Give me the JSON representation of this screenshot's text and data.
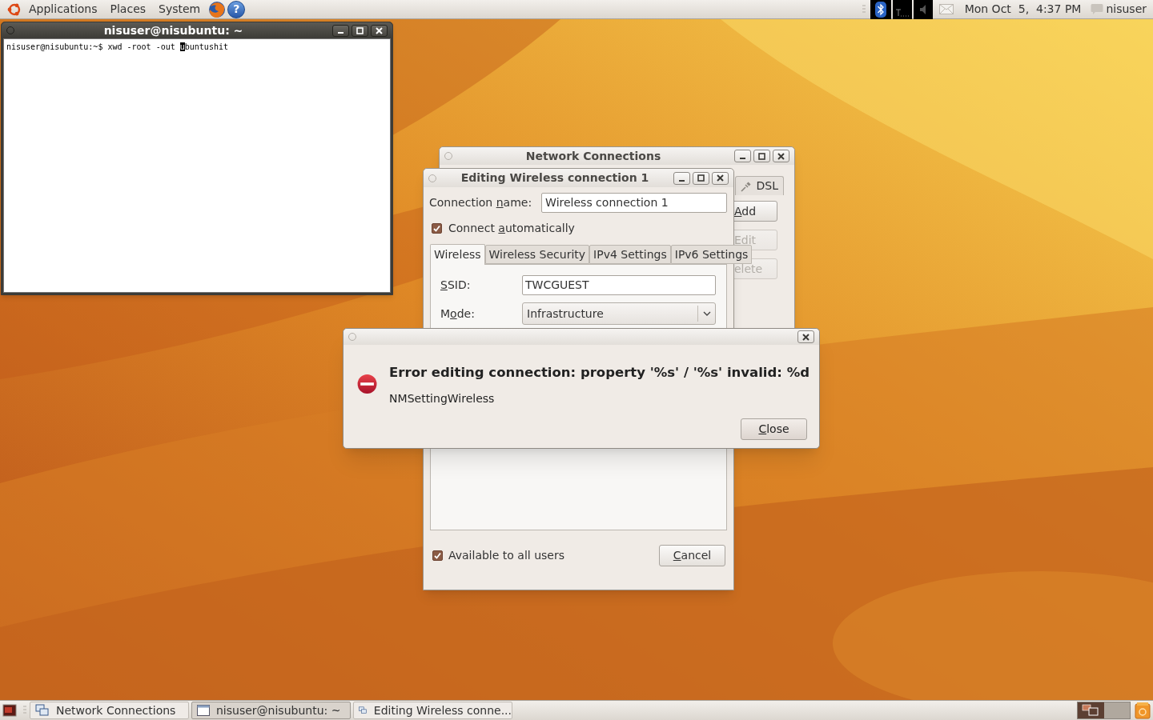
{
  "top_panel": {
    "menus": [
      "Applications",
      "Places",
      "System"
    ],
    "help_glyph": "?",
    "clock": "Mon Oct  5,  4:37 PM",
    "user": "nisuser"
  },
  "terminal": {
    "title": "nisuser@nisubuntu: ~",
    "active": true,
    "line": {
      "text": "nisuser@nisubuntu:~$ xwd -root -out ",
      "cursor": "u",
      "after": "buntushit"
    }
  },
  "network_connections": {
    "title": "Network Connections",
    "active": false,
    "tab": "DSL",
    "buttons": [
      {
        "label": {
          "key": "A",
          "post": "dd"
        },
        "disabled": false
      },
      {
        "label": {
          "post": "Edit"
        },
        "disabled": true
      },
      {
        "label": {
          "post": "elete"
        },
        "disabled": true
      }
    ]
  },
  "edit_dialog": {
    "title": "Editing Wireless connection 1",
    "active": false,
    "name_label": {
      "pre": "Connection ",
      "key": "n",
      "post": "ame:"
    },
    "name_value": "Wireless connection 1",
    "auto_connect": {
      "label": {
        "pre": "Connect ",
        "key": "a",
        "post": "utomatically"
      },
      "checked": true
    },
    "tabs": [
      {
        "label": "Wireless",
        "selected": true
      },
      {
        "label": "Wireless Security",
        "selected": false
      },
      {
        "label": "IPv4 Settings",
        "selected": false
      },
      {
        "label": "IPv6 Settings",
        "selected": false
      }
    ],
    "fields": [
      {
        "kind": "text",
        "label": {
          "key": "S",
          "post": "SID:"
        },
        "value": "TWCGUEST"
      },
      {
        "kind": "combo",
        "label": {
          "pre": "M",
          "key": "o",
          "post": "de:"
        },
        "value": "Infrastructure"
      }
    ],
    "all_users": {
      "label": {
        "post": "Available to all users"
      },
      "checked": true
    },
    "cancel": {
      "key": "C",
      "post": "ancel"
    }
  },
  "error_dialog": {
    "message": "Error editing connection: property '%s' / '%s' invalid: %d",
    "detail": "NMSettingWireless",
    "close": {
      "key": "C",
      "post": "lose"
    }
  },
  "taskbar": {
    "tasks": [
      {
        "kind": "network",
        "label": "Network Connections",
        "selected": false
      },
      {
        "kind": "terminal",
        "label": "nisuser@nisubuntu: ~",
        "selected": true
      },
      {
        "kind": "network",
        "label": "Editing Wireless conne...",
        "selected": false
      }
    ]
  }
}
